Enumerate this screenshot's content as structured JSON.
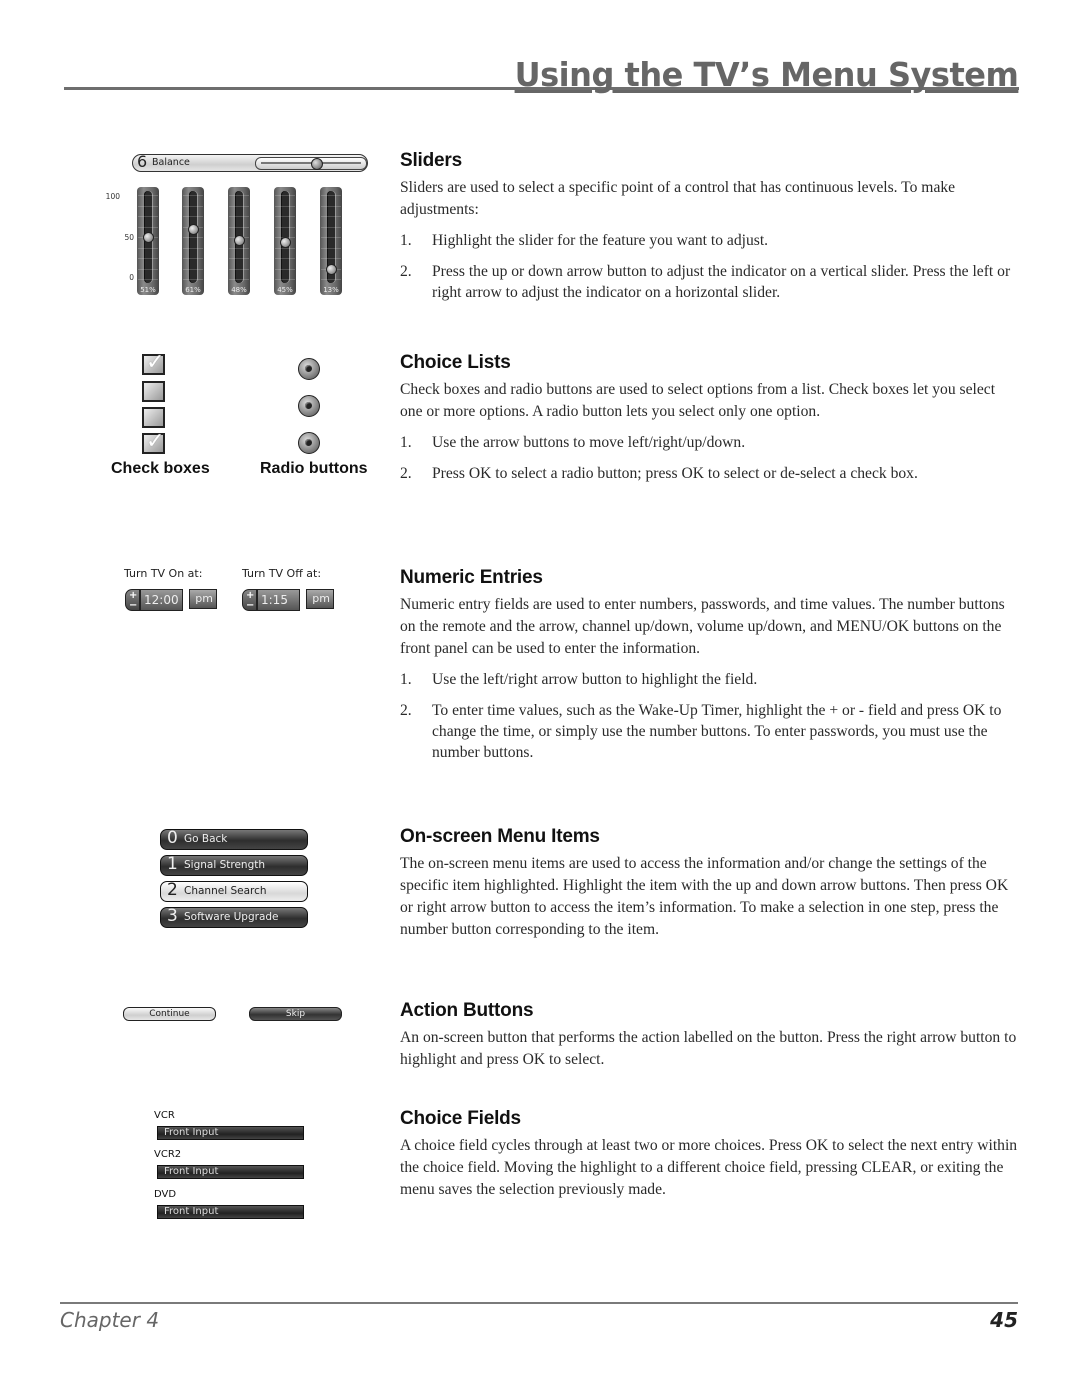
{
  "header": {
    "title": "Using the TV’s Menu System"
  },
  "footer": {
    "chapter": "Chapter 4",
    "page": "45"
  },
  "illustrations": {
    "balance": {
      "number": "6",
      "label": "Balance",
      "value_fraction": 0.6
    },
    "vertical_sliders": {
      "axis_labels": [
        "100",
        "50",
        "0"
      ],
      "sliders": [
        {
          "percent_label": "51%",
          "value": 51
        },
        {
          "percent_label": "61%",
          "value": 61
        },
        {
          "percent_label": "48%",
          "value": 48
        },
        {
          "percent_label": "45%",
          "value": 45
        },
        {
          "percent_label": "13%",
          "value": 13
        }
      ]
    },
    "check_boxes": {
      "label": "Check boxes",
      "states": [
        true,
        false,
        false,
        true
      ],
      "check_glyph": "✓"
    },
    "radio_buttons": {
      "label": "Radio buttons",
      "count": 3
    },
    "numeric": {
      "on": {
        "label": "Turn TV On at:",
        "time": "12:00",
        "ampm": "pm"
      },
      "off": {
        "label": "Turn TV Off at:",
        "time": "1:15",
        "ampm": "pm"
      },
      "plus": "+",
      "minus": "−"
    },
    "menu_items": [
      {
        "number": "0",
        "label": "Go Back",
        "selected": false
      },
      {
        "number": "1",
        "label": "Signal Strength",
        "selected": false
      },
      {
        "number": "2",
        "label": "Channel Search",
        "selected": true
      },
      {
        "number": "3",
        "label": "Software Upgrade",
        "selected": false
      }
    ],
    "action_buttons": {
      "continue": "Continue",
      "skip": "Skip"
    },
    "choice_fields": [
      {
        "label": "VCR",
        "value": "Front Input"
      },
      {
        "label": "VCR2",
        "value": "Front Input"
      },
      {
        "label": "DVD",
        "value": "Front Input"
      }
    ]
  },
  "sections": {
    "sliders": {
      "heading": "Sliders",
      "body": "Sliders are used to select a specific point of a control that has continuous levels. To make adjustments:",
      "steps": [
        {
          "num": "1.",
          "text": "Highlight the slider for the feature you want to adjust."
        },
        {
          "num": "2.",
          "text": "Press the up or down arrow button to adjust the indicator on a vertical slider. Press the left or right arrow to adjust the indicator on a horizontal slider."
        }
      ]
    },
    "choice_lists": {
      "heading": "Choice Lists",
      "body": "Check boxes and radio buttons are used to select options from a list. Check boxes let you select one or more options. A radio button lets you select only one option.",
      "steps": [
        {
          "num": "1.",
          "text": "Use the arrow buttons to move left/right/up/down."
        },
        {
          "num": "2.",
          "text": "Press OK to select a radio button; press OK to select or de-select a check box."
        }
      ]
    },
    "numeric_entries": {
      "heading": "Numeric Entries",
      "body": "Numeric entry fields are used to enter numbers, passwords, and time values. The number buttons on the remote and the arrow, channel up/down, volume up/down, and MENU/OK buttons on the front panel can be used to enter the information.",
      "steps": [
        {
          "num": "1.",
          "text": "Use the left/right arrow button to highlight the field."
        },
        {
          "num": "2.",
          "text": "To enter time values, such as the Wake-Up Timer, highlight the + or - field and press OK to change the time, or simply use the number buttons. To enter passwords, you must use the number buttons."
        }
      ]
    },
    "menu_items": {
      "heading": "On-screen Menu Items",
      "body": "The on-screen menu items are used to access the information and/or change the settings of the specific item highlighted. Highlight the item with the up and down arrow buttons. Then press OK or right arrow button to access the item’s information. To make a selection in one step, press the number button corresponding to the item."
    },
    "action_buttons": {
      "heading": "Action Buttons",
      "body": "An on-screen button that performs the action labelled on the button. Press the right arrow button to highlight and press OK to select."
    },
    "choice_fields": {
      "heading": "Choice Fields",
      "body": "A choice field cycles through at least two or more choices. Press OK to select the next entry within the choice field. Moving the highlight to a different choice field, pressing CLEAR, or exiting the menu saves the selection previously made."
    }
  }
}
